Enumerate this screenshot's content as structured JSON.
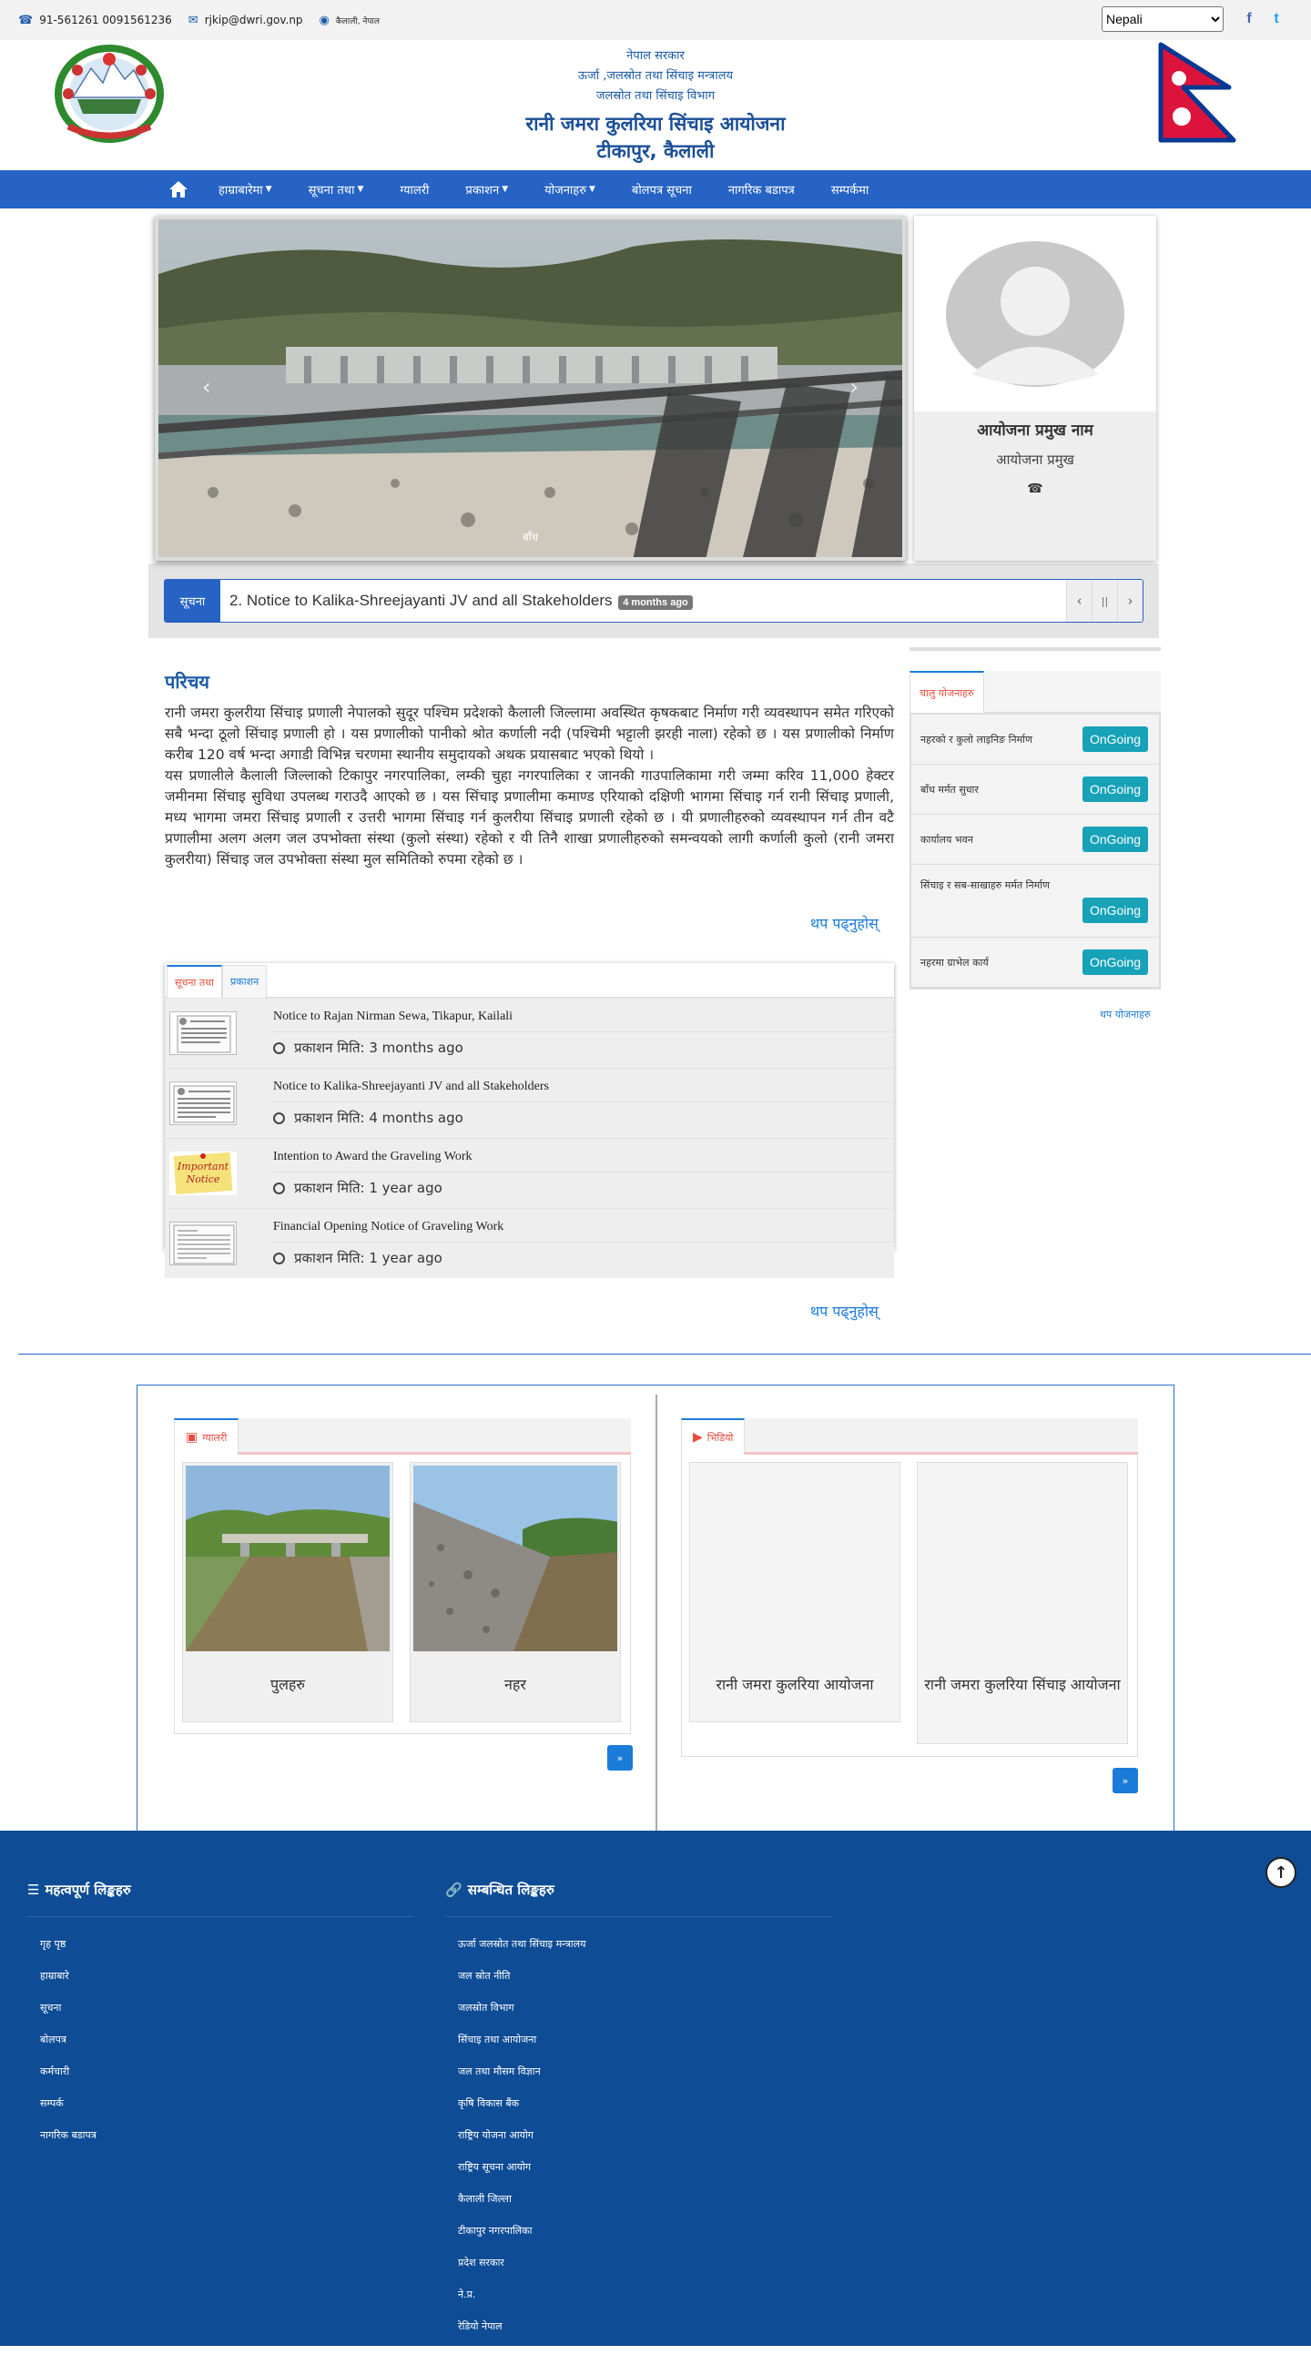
{
  "topbar": {
    "phone": "91-561261 0091561236",
    "email": "rjkip@dwri.gov.np",
    "location": "कैलाली, नेपाल",
    "language_selected": "Nepali",
    "facebook_icon": "f",
    "twitter_icon": "t"
  },
  "header": {
    "line1": "नेपाल सरकार",
    "line2": "ऊर्जा ,जलस्रोत तथा सिंचाइ मन्त्रालय",
    "line3": "जलस्रोत तथा सिंचाइ विभाग",
    "line4": "रानी जमरा कुलरिया सिंचाइ आयोजना",
    "line5": "टीकापुर, कैलाली"
  },
  "nav": {
    "items": [
      {
        "label": "हाम्राबारेमा",
        "dropdown": true
      },
      {
        "label": "सूचना तथा",
        "dropdown": true
      },
      {
        "label": "ग्यालरी",
        "dropdown": false
      },
      {
        "label": "प्रकाशन",
        "dropdown": true
      },
      {
        "label": "योजनाहरु",
        "dropdown": true
      },
      {
        "label": "बोलपत्र सूचना",
        "dropdown": false
      },
      {
        "label": "नागरिक बडापत्र",
        "dropdown": false
      },
      {
        "label": "सम्पर्कमा",
        "dropdown": false
      }
    ]
  },
  "slider": {
    "caption": "बाँध",
    "prev_icon": "‹",
    "next_icon": "›"
  },
  "profile": {
    "name": "आयोजना प्रमुख नाम",
    "designation": "आयोजना प्रमुख",
    "phone_icon": "☎"
  },
  "ticker": {
    "label": "सूचना",
    "text": "2. Notice to Kalika-Shreejayanti JV and all Stakeholders",
    "badge": "4 months ago",
    "prev_icon": "‹",
    "pause_icon": "||",
    "next_icon": "›"
  },
  "about": {
    "heading": "परिचय",
    "para1": "रानी जमरा कुलरीया सिंचाइ प्रणाली नेपालको सुदूर पश्चिम प्रदेशको कैलाली जिल्लामा अवस्थित कृषकबाट निर्माण गरी व्यवस्थापन समेत गरिएको सबै भन्दा ठूलो सिंचाइ प्रणाली हो । यस प्रणालीको पानीको श्रोत कर्णाली नदी (पश्चिमी भट्टाली झरही नाला) रहेको छ । यस प्रणालीको निर्माण करीब 120 वर्ष भन्दा अगाडी विभिन्न चरणमा स्थानीय समुदायको अथक प्रयासबाट भएको थियो ।",
    "para2": "यस प्रणालीले कैलाली जिल्लाको टिकापुर नगरपालिका, लम्की चुहा नगरपालिका र जानकी गाउपालिकामा गरी जम्मा करिव 11,000 हेक्टर जमीनमा सिंचाइ सुविधा उपलब्ध गराउदै आएको छ । यस सिंचाइ प्रणालीमा कमाण्ड एरियाको दक्षिणी भागमा सिंचाइ गर्न रानी सिंचाइ प्रणाली, मध्य भागमा जमरा सिंचाइ प्रणाली र उत्तरी भागमा सिंचाइ गर्न कुलरीया सिंचाइ प्रणाली रहेको छ । यी प्रणालीहरुको व्यवस्थापन गर्न तीन वटै प्रणालीमा अलग अलग जल उपभोक्ता संस्था (कुलो संस्था) रहेको र यी तिनै शाखा प्रणालीहरुको समन्वयको लागी कर्णाली कुलो (रानी जमरा कुलरीया) सिंचाइ जल उपभोक्ता संस्था मुल समितिको रुपमा रहेको छ ।",
    "readmore": "थप पढ्नुहोस्"
  },
  "notices": {
    "tab_active": "सूचना तथा",
    "tab_inactive": "प्रकाशन",
    "items": [
      {
        "title": "Notice to Rajan Nirman Sewa, Tikapur, Kailali",
        "date": "प्रकाशन मिति: 3 months ago",
        "thumb": "doc"
      },
      {
        "title": "Notice to Kalika-Shreejayanti JV and all Stakeholders",
        "date": "प्रकाशन मिति: 4 months ago",
        "thumb": "doc"
      },
      {
        "title": "Intention to Award the Graveling Work",
        "date": "प्रकाशन मिति: 1 year ago",
        "thumb": "important"
      },
      {
        "title": "Financial Opening Notice of Graveling Work",
        "date": "प्रकाशन मिति: 1 year ago",
        "thumb": "doc2"
      }
    ],
    "readmore": "थप पढ्नुहोस्",
    "important_line1": "Important",
    "important_line2": "Notice"
  },
  "projects": {
    "tab": "चालु योजनाहरु",
    "items": [
      {
        "name": "नहरको र कुलो लाइनिङ निर्माण",
        "status": "OnGoing"
      },
      {
        "name": "बाँध मर्मत सुधार",
        "status": "OnGoing"
      },
      {
        "name": "कार्यालय भवन",
        "status": "OnGoing"
      },
      {
        "name": "सिंचाइ र सब-साखाहरु मर्मत निर्माण",
        "status": "OnGoing"
      },
      {
        "name": "नहरमा ग्राभेल कार्य",
        "status": "OnGoing"
      }
    ],
    "more": "थप योजनाहरु"
  },
  "gallery": {
    "photo_tab": "ग्यालरी",
    "video_tab": "भिडियो",
    "photos": [
      {
        "caption": "पुलहरु"
      },
      {
        "caption": "नहर"
      }
    ],
    "videos": [
      {
        "caption": "रानी जमरा कुलरिया आयोजना"
      },
      {
        "caption": "रानी जमरा कुलरिया सिंचाइ आयोजना"
      }
    ],
    "photo_more": "»",
    "video_more": "»"
  },
  "footer": {
    "col1_title": "महत्वपूर्ण लिङ्कहरु",
    "col1_items": [
      "गृह पृष्ठ",
      "हाम्राबारे",
      "सूचना",
      "बोलपत्र",
      "कर्मचारी",
      "सम्पर्क",
      "नागरिक बडापत्र"
    ],
    "col2_title": "सम्बन्धित लिङ्कहरु",
    "col2_items": [
      "ऊर्जा जलस्रोत तथा सिंचाइ मन्त्रालय",
      "जल स्रोत नीति",
      "जलस्रोत विभाग",
      "सिंचाइ तथा आयोजना",
      "जल तथा मौसम विज्ञान",
      "कृषि विकास बैंक",
      "राष्ट्रिय योजना आयोग",
      "राष्ट्रिय सूचना आयोग",
      "कैलाली जिल्ला",
      "टीकापुर नगरपालिका",
      "प्रदेश सरकार",
      "ने.प्र.",
      "रेडियो नेपाल"
    ],
    "top_icon": "↑"
  }
}
